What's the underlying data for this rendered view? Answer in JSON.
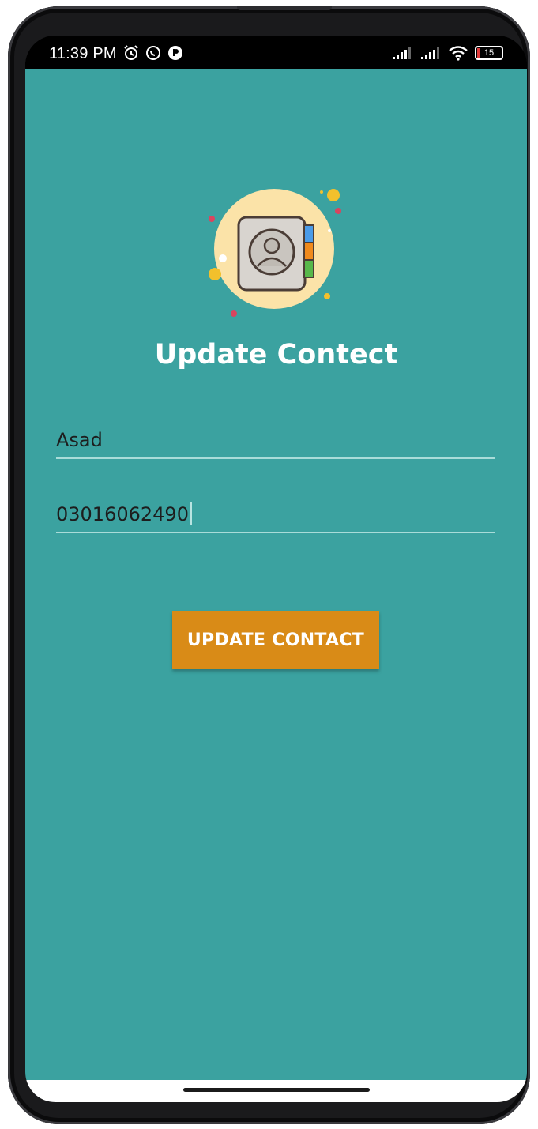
{
  "status_bar": {
    "time": "11:39 PM",
    "left_icons": [
      "alarm-icon",
      "whatsapp-icon",
      "app-notification-icon"
    ],
    "right_icons": [
      "signal-icon",
      "signal-icon",
      "wifi-icon",
      "battery-icon"
    ],
    "battery_level": "15",
    "battery_color": "#e23b3b"
  },
  "app": {
    "background_color": "#3ba2a0",
    "logo_icon": "contact-book-icon",
    "title": "Update Contect",
    "name_field": {
      "value": "Asad"
    },
    "phone_field": {
      "value": "03016062490"
    },
    "update_button": {
      "label": "UPDATE CONTACT",
      "color": "#d98b17"
    }
  }
}
